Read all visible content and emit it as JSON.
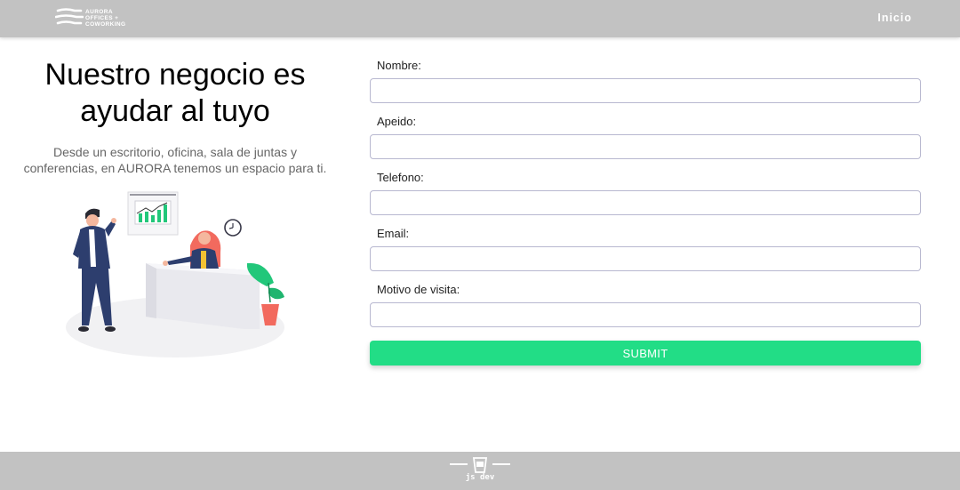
{
  "header": {
    "logo_lines": [
      "AURORA",
      "OFFICES +",
      "COWORKING"
    ],
    "nav_inicio": "Inicio"
  },
  "hero": {
    "title": "Nuestro negocio es ayudar al tuyo",
    "subtitle": "Desde un escritorio, oficina, sala de juntas y conferencias, en AURORA tenemos un espacio para ti."
  },
  "illustration": {
    "icons": [
      "chart-board-icon",
      "clock-icon",
      "plant-icon",
      "man-figure",
      "woman-figure",
      "reception-desk"
    ]
  },
  "form": {
    "fields": [
      {
        "label": "Nombre:",
        "value": "",
        "placeholder": ""
      },
      {
        "label": "Apeido:",
        "value": "",
        "placeholder": ""
      },
      {
        "label": "Telefono:",
        "value": "",
        "placeholder": ""
      },
      {
        "label": "Email:",
        "value": "",
        "placeholder": ""
      },
      {
        "label": "Motivo de visita:",
        "value": "",
        "placeholder": ""
      }
    ],
    "submit_label": "SUBMIT"
  },
  "footer": {
    "brand": "js dev"
  },
  "colors": {
    "bar": "#c2c2c2",
    "accent": "#22dd86",
    "input_border": "#b8b8d0",
    "subtitle": "#666666"
  }
}
